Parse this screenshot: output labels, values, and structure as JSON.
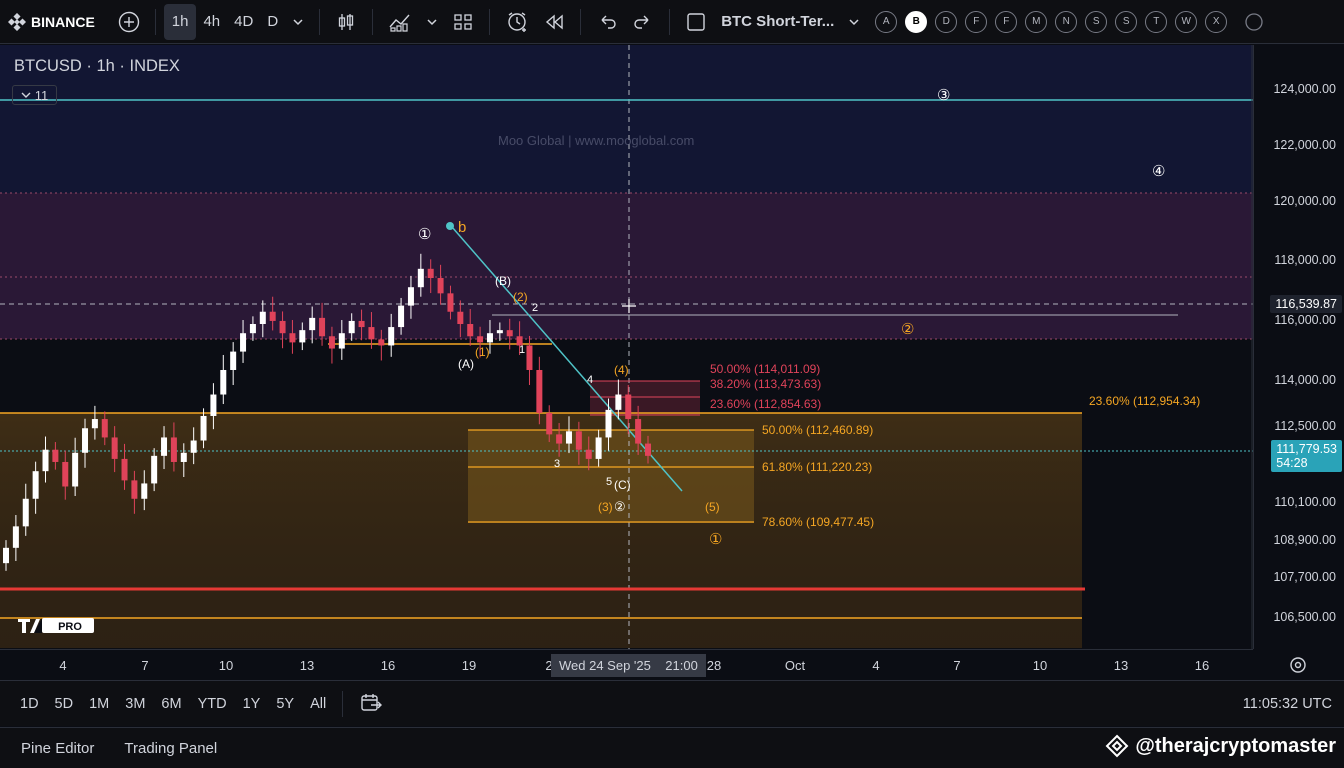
{
  "toolbar": {
    "brand": "BINANCE",
    "intervals": [
      "1h",
      "4h",
      "4D",
      "D"
    ],
    "active_interval": "1h",
    "layout_title": "BTC Short-Ter...",
    "letters": [
      "A",
      "B",
      "D",
      "F",
      "F",
      "M",
      "N",
      "S",
      "S",
      "T",
      "W",
      "X"
    ],
    "selected_letter": "B"
  },
  "legend": {
    "symbol": "BTCUSD · 1h · INDEX",
    "indicators_count": "11"
  },
  "price_axis": {
    "ticks": [
      "124,000.00",
      "122,000.00",
      "120,000.00",
      "118,000.00",
      "116,000.00",
      "114,000.00",
      "112,500.00",
      "110,100.00",
      "108,900.00",
      "107,700.00",
      "106,500.00"
    ],
    "crosshair_price": "116,539.87",
    "last_price": "111,779.53",
    "countdown": "54:28"
  },
  "time_axis": {
    "ticks": [
      "4",
      "7",
      "10",
      "13",
      "16",
      "19",
      "2",
      "28",
      "Oct",
      "4",
      "7",
      "10",
      "13",
      "16"
    ],
    "crosshair_label": "Wed 24 Sep '25    21:00"
  },
  "fib_labels": {
    "upper": [
      "50.00% (114,011.09)",
      "38.20% (113,473.63)",
      "23.60% (112,854.63)"
    ],
    "right": "23.60% (112,954.34)",
    "lower": [
      "50.00% (112,460.89)",
      "61.80% (111,220.23)",
      "78.60% (109,477.45)"
    ]
  },
  "wave_labels": {
    "white": [
      "①",
      "③",
      "④",
      "(A)",
      "(B)",
      "(C)",
      "1",
      "2",
      "3",
      "4",
      "5",
      "②"
    ],
    "orange": [
      "b",
      "②",
      "(2)",
      "(1)",
      "(4)",
      "(3)",
      "(5)",
      "①"
    ]
  },
  "watermark": "Moo Global  |  www.mooglobal.com",
  "range_bar": {
    "ranges": [
      "1D",
      "5D",
      "1M",
      "3M",
      "6M",
      "YTD",
      "1Y",
      "5Y",
      "All"
    ],
    "clock": "11:05:32 UTC"
  },
  "bottom_bar": {
    "tabs": [
      "Pine Editor",
      "Trading Panel"
    ],
    "handle": "@therajcryptomaster"
  },
  "colors": {
    "background": "#0b0d14",
    "bull": "#ffffff",
    "bear": "#e0435a",
    "fib_orange": "#f5a623",
    "cyan_line": "#4fc3c7",
    "red_level": "#e53935"
  },
  "chart_data": {
    "type": "candlestick",
    "symbol": "BTCUSD",
    "interval": "1h",
    "ylim": [
      105500,
      125200
    ],
    "close_series": [
      108800,
      109500,
      110400,
      111300,
      112000,
      111600,
      110800,
      111900,
      112700,
      113000,
      112400,
      111700,
      111000,
      110400,
      110900,
      111800,
      112400,
      111600,
      111900,
      112300,
      113100,
      113800,
      114600,
      115200,
      115800,
      116100,
      116500,
      116200,
      115800,
      115500,
      115900,
      116300,
      115700,
      115300,
      115800,
      116200,
      116000,
      115600,
      115400,
      116000,
      116700,
      117300,
      117900,
      117600,
      117100,
      116500,
      116100,
      115700,
      115500,
      115800,
      115900,
      115700,
      115400,
      114600,
      113200,
      112500,
      112200,
      112600,
      112000,
      111700,
      112400,
      113300,
      113800,
      113000,
      112200,
      111800
    ],
    "levels": [
      {
        "name": "23.60%",
        "value": 112954.34
      },
      {
        "name": "50.00%",
        "value": 112460.89
      },
      {
        "name": "61.80%",
        "value": 111220.23
      },
      {
        "name": "78.60%",
        "value": 109477.45
      },
      {
        "name": "50.00%",
        "value": 114011.09
      },
      {
        "name": "38.20%",
        "value": 113473.63
      },
      {
        "name": "23.60%",
        "value": 112854.63
      }
    ]
  }
}
